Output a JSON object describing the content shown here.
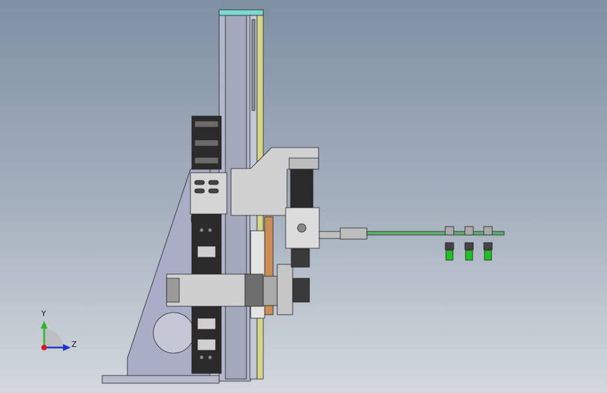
{
  "viewport": {
    "background_top": "#7f90a3",
    "background_bottom": "#d3d8de"
  },
  "triad": {
    "y_label": "Y",
    "z_label": "Z",
    "y_color": "#2db52d",
    "z_color": "#2136c8",
    "x_color": "#d21d1d"
  },
  "colors": {
    "frame": "#a9aec6",
    "frame_dark": "#7c8198",
    "chain": "#2b2b2b",
    "plate": "#d0d0d0",
    "rail_yellow": "#d5d68b",
    "rail_cyan": "#7dd8d2",
    "copper": "#c98d55",
    "arm_green": "#5fb06f",
    "nozzle": "#22c022"
  }
}
